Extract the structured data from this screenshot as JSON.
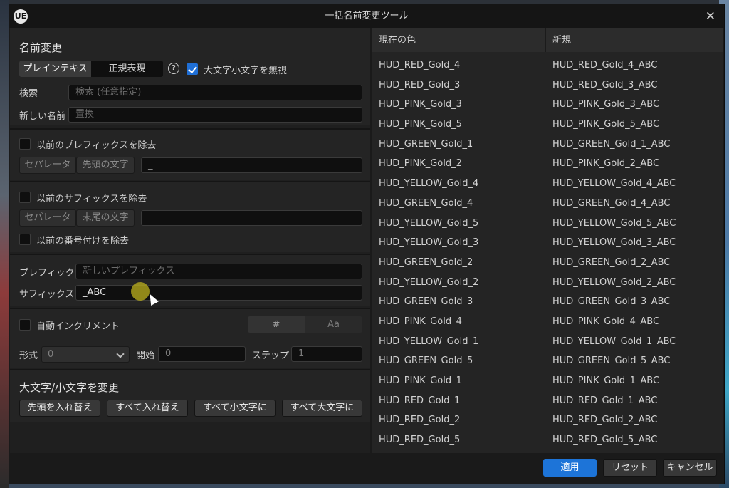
{
  "window": {
    "title": "一括名前変更ツール",
    "logo": "UE"
  },
  "rename": {
    "heading": "名前変更",
    "mode_plain": "プレインテキスト",
    "mode_regex": "正規表現",
    "help_glyph": "?",
    "ignore_case_label": "大文字小文字を無視",
    "ignore_case_checked": true,
    "search_label": "検索",
    "search_placeholder": "検索 (任意指定)",
    "newname_label": "新しい名前",
    "newname_placeholder": "置換"
  },
  "prefix_remove": {
    "label": "以前のプレフィックスを除去",
    "separator_tab": "セパレータ",
    "char_tab": "先頭の文字",
    "value": "_"
  },
  "suffix_remove": {
    "label": "以前のサフィックスを除去",
    "separator_tab": "セパレータ",
    "char_tab": "末尾の文字",
    "value": "_"
  },
  "numbering_remove": {
    "label": "以前の番号付けを除去"
  },
  "affix": {
    "prefix_label": "プレフィック.",
    "prefix_placeholder": "新しいプレフィックス",
    "suffix_label": "サフィックス",
    "suffix_value": "_ABC"
  },
  "increment": {
    "label": "自動インクリメント",
    "mode_hash": "#",
    "mode_aa": "Aa",
    "format_label": "形式",
    "format_value": "0",
    "start_label": "開始",
    "start_value": "0",
    "step_label": "ステップ",
    "step_value": "1"
  },
  "casing": {
    "heading": "大文字/小文字を変更",
    "buttons": [
      "先頭を入れ替え",
      "すべて入れ替え",
      "すべて小文字に",
      "すべて大文字に"
    ]
  },
  "table": {
    "col_current": "現在の色",
    "col_new": "新規",
    "rows": [
      {
        "current": "HUD_RED_Gold_4",
        "new": "HUD_RED_Gold_4_ABC"
      },
      {
        "current": "HUD_RED_Gold_3",
        "new": "HUD_RED_Gold_3_ABC"
      },
      {
        "current": "HUD_PINK_Gold_3",
        "new": "HUD_PINK_Gold_3_ABC"
      },
      {
        "current": "HUD_PINK_Gold_5",
        "new": "HUD_PINK_Gold_5_ABC"
      },
      {
        "current": "HUD_GREEN_Gold_1",
        "new": "HUD_GREEN_Gold_1_ABC"
      },
      {
        "current": "HUD_PINK_Gold_2",
        "new": "HUD_PINK_Gold_2_ABC"
      },
      {
        "current": "HUD_YELLOW_Gold_4",
        "new": "HUD_YELLOW_Gold_4_ABC"
      },
      {
        "current": "HUD_GREEN_Gold_4",
        "new": "HUD_GREEN_Gold_4_ABC"
      },
      {
        "current": "HUD_YELLOW_Gold_5",
        "new": "HUD_YELLOW_Gold_5_ABC"
      },
      {
        "current": "HUD_YELLOW_Gold_3",
        "new": "HUD_YELLOW_Gold_3_ABC"
      },
      {
        "current": "HUD_GREEN_Gold_2",
        "new": "HUD_GREEN_Gold_2_ABC"
      },
      {
        "current": "HUD_YELLOW_Gold_2",
        "new": "HUD_YELLOW_Gold_2_ABC"
      },
      {
        "current": "HUD_GREEN_Gold_3",
        "new": "HUD_GREEN_Gold_3_ABC"
      },
      {
        "current": "HUD_PINK_Gold_4",
        "new": "HUD_PINK_Gold_4_ABC"
      },
      {
        "current": "HUD_YELLOW_Gold_1",
        "new": "HUD_YELLOW_Gold_1_ABC"
      },
      {
        "current": "HUD_GREEN_Gold_5",
        "new": "HUD_GREEN_Gold_5_ABC"
      },
      {
        "current": "HUD_PINK_Gold_1",
        "new": "HUD_PINK_Gold_1_ABC"
      },
      {
        "current": "HUD_RED_Gold_1",
        "new": "HUD_RED_Gold_1_ABC"
      },
      {
        "current": "HUD_RED_Gold_2",
        "new": "HUD_RED_Gold_2_ABC"
      },
      {
        "current": "HUD_RED_Gold_5",
        "new": "HUD_RED_Gold_5_ABC"
      }
    ]
  },
  "footer": {
    "apply": "適用",
    "reset": "リセット",
    "cancel": "キャンセル"
  },
  "colors": {
    "accent": "#1d74d8",
    "panel": "#242424",
    "field": "#0f0f0f"
  }
}
